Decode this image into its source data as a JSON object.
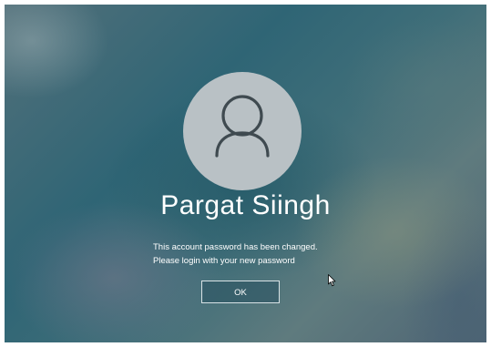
{
  "user": {
    "name": "Pargat Siingh",
    "avatar_icon": "person-icon"
  },
  "message": {
    "line1": "This account password has been changed.",
    "line2": "Please login with your new password"
  },
  "ok_button": {
    "label": "OK"
  },
  "icons": {
    "cursor": "mouse-pointer-icon"
  },
  "colors": {
    "avatar_bg": "#b9c1c5",
    "avatar_glyph": "#3f4a50",
    "text": "#ffffff"
  }
}
